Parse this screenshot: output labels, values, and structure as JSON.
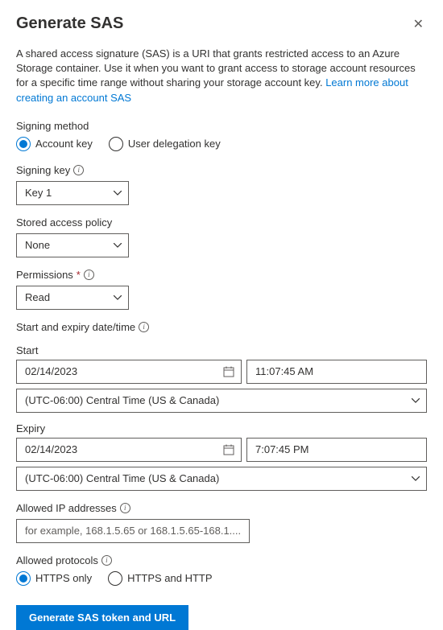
{
  "title": "Generate SAS",
  "description_text": "A shared access signature (SAS) is a URI that grants restricted access to an Azure Storage container. Use it when you want to grant access to storage account resources for a specific time range without sharing your storage account key. ",
  "description_link": "Learn more about creating an account SAS",
  "signing_method": {
    "label": "Signing method",
    "option1": "Account key",
    "option2": "User delegation key"
  },
  "signing_key": {
    "label": "Signing key",
    "value": "Key 1"
  },
  "stored_policy": {
    "label": "Stored access policy",
    "value": "None"
  },
  "permissions": {
    "label": "Permissions",
    "value": "Read"
  },
  "datetime": {
    "header": "Start and expiry date/time",
    "start_label": "Start",
    "start_date": "02/14/2023",
    "start_time": "11:07:45 AM",
    "start_tz": "(UTC-06:00) Central Time (US & Canada)",
    "expiry_label": "Expiry",
    "expiry_date": "02/14/2023",
    "expiry_time": "7:07:45 PM",
    "expiry_tz": "(UTC-06:00) Central Time (US & Canada)"
  },
  "allowed_ip": {
    "label": "Allowed IP addresses",
    "placeholder": "for example, 168.1.5.65 or 168.1.5.65-168.1...."
  },
  "allowed_protocols": {
    "label": "Allowed protocols",
    "option1": "HTTPS only",
    "option2": "HTTPS and HTTP"
  },
  "generate_button": "Generate SAS token and URL"
}
